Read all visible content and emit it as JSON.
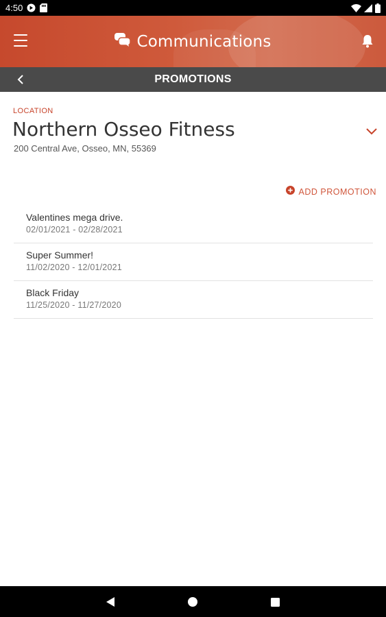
{
  "status_bar": {
    "time": "4:50",
    "icons": [
      "google-play-icon",
      "sd-card-icon",
      "wifi-icon",
      "signal-icon",
      "battery-icon"
    ]
  },
  "header": {
    "title": "Communications",
    "icons": [
      "menu-icon",
      "chat-icon",
      "bell-icon"
    ]
  },
  "sub_header": {
    "title": "PROMOTIONS",
    "back_icon": "chevron-left-icon"
  },
  "location": {
    "label": "LOCATION",
    "name": "Northern Osseo Fitness",
    "address": "200 Central Ave, Osseo, MN, 55369",
    "dropdown_icon": "chevron-down-icon"
  },
  "actions": {
    "add_promotion_label": "ADD PROMOTION",
    "add_icon": "plus-circle-icon"
  },
  "promotions": [
    {
      "name": "Valentines mega drive.",
      "dates": "02/01/2021 - 02/28/2021"
    },
    {
      "name": "Super Summer!",
      "dates": "11/02/2020 - 12/01/2021"
    },
    {
      "name": "Black Friday",
      "dates": "11/25/2020 - 11/27/2020"
    }
  ],
  "nav_bar": {
    "icons": [
      "back-triangle-icon",
      "home-circle-icon",
      "recents-square-icon"
    ]
  },
  "colors": {
    "brand": "#c7432a",
    "header_bg": "#cc5a3d",
    "subheader_bg": "#4a4a4a"
  }
}
